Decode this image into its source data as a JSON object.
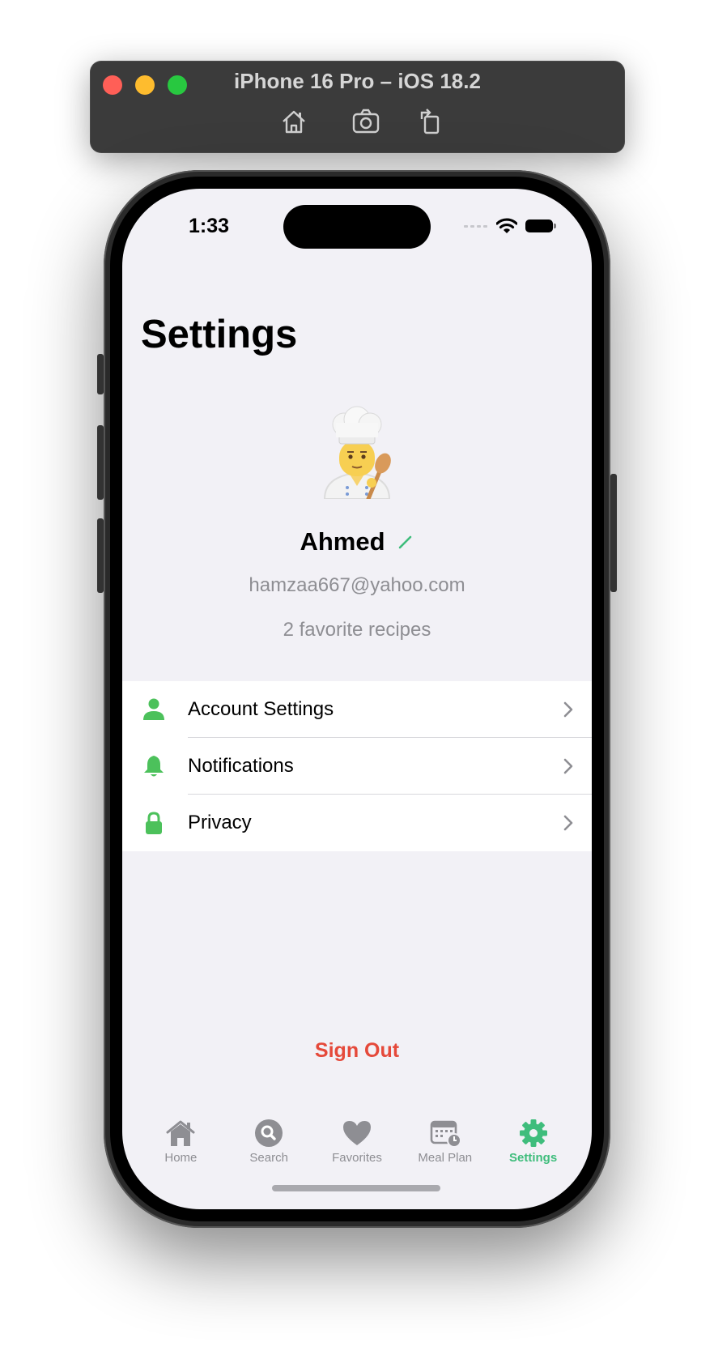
{
  "simulator": {
    "title": "iPhone 16 Pro – iOS 18.2",
    "tools": [
      {
        "icon": "home-icon"
      },
      {
        "icon": "camera-icon"
      },
      {
        "icon": "rotate-icon"
      }
    ]
  },
  "status_bar": {
    "time": "1:33"
  },
  "page": {
    "title": "Settings"
  },
  "profile": {
    "avatar": "chef-emoji",
    "name": "Ahmed",
    "edit_icon": "pencil-icon",
    "email": "hamzaa667@yahoo.com",
    "favorites_text": "2 favorite recipes"
  },
  "menu": {
    "items": [
      {
        "label": "Account Settings",
        "icon": "person-icon"
      },
      {
        "label": "Notifications",
        "icon": "bell-icon"
      },
      {
        "label": "Privacy",
        "icon": "lock-icon"
      }
    ]
  },
  "sign_out": {
    "label": "Sign Out"
  },
  "tabbar": {
    "items": [
      {
        "label": "Home",
        "icon": "house-icon"
      },
      {
        "label": "Search",
        "icon": "search-icon"
      },
      {
        "label": "Favorites",
        "icon": "heart-icon"
      },
      {
        "label": "Meal Plan",
        "icon": "calendar-clock-icon"
      },
      {
        "label": "Settings",
        "icon": "gear-icon"
      }
    ],
    "active": "Settings"
  },
  "colors": {
    "accent": "#3fbd7c",
    "icon_green": "#4cc15b",
    "destructive": "#e5493a",
    "secondary_text": "#8e8e93",
    "background": "#f2f1f6"
  }
}
